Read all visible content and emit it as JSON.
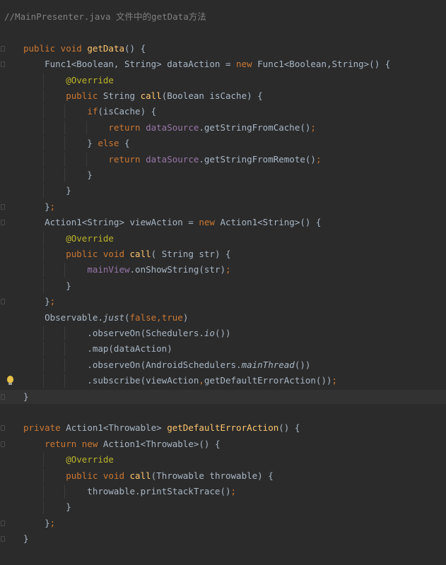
{
  "editor": {
    "current_line_index": 24,
    "lines": [
      {
        "fold": false,
        "bulb": false,
        "tokens": [
          {
            "t": "//MainPresenter.java 文件中的getData方法",
            "c": "comment"
          }
        ]
      },
      {
        "fold": false,
        "bulb": false,
        "tokens": []
      },
      {
        "fold": true,
        "bulb": false,
        "tokens": [
          {
            "t": "public void ",
            "c": "kw"
          },
          {
            "t": "getData",
            "c": "fn"
          },
          {
            "t": "() {",
            "c": "pl"
          }
        ]
      },
      {
        "fold": true,
        "bulb": false,
        "tokens": [
          {
            "t": "    Func1<Boolean, String> dataAction = ",
            "c": "pl"
          },
          {
            "t": "new ",
            "c": "kw"
          },
          {
            "t": "Func1<Boolean,String>() {",
            "c": "pl"
          }
        ]
      },
      {
        "fold": false,
        "bulb": false,
        "tokens": [
          {
            "t": "        ",
            "c": "pl"
          },
          {
            "t": "@Override",
            "c": "ann"
          }
        ]
      },
      {
        "fold": false,
        "bulb": false,
        "tokens": [
          {
            "t": "        ",
            "c": "pl"
          },
          {
            "t": "public ",
            "c": "kw"
          },
          {
            "t": "String ",
            "c": "pl"
          },
          {
            "t": "call",
            "c": "fn"
          },
          {
            "t": "(Boolean isCache) {",
            "c": "pl"
          }
        ]
      },
      {
        "fold": false,
        "bulb": false,
        "tokens": [
          {
            "t": "            ",
            "c": "pl"
          },
          {
            "t": "if",
            "c": "kw"
          },
          {
            "t": "(isCache) {",
            "c": "pl"
          }
        ]
      },
      {
        "fold": false,
        "bulb": false,
        "tokens": [
          {
            "t": "                ",
            "c": "pl"
          },
          {
            "t": "return ",
            "c": "kw"
          },
          {
            "t": "dataSource",
            "c": "fld"
          },
          {
            "t": ".getStringFromCache()",
            "c": "pl"
          },
          {
            "t": ";",
            "c": "kw"
          }
        ]
      },
      {
        "fold": false,
        "bulb": false,
        "tokens": [
          {
            "t": "            } ",
            "c": "pl"
          },
          {
            "t": "else ",
            "c": "kw"
          },
          {
            "t": "{",
            "c": "pl"
          }
        ]
      },
      {
        "fold": false,
        "bulb": false,
        "tokens": [
          {
            "t": "                ",
            "c": "pl"
          },
          {
            "t": "return ",
            "c": "kw"
          },
          {
            "t": "dataSource",
            "c": "fld"
          },
          {
            "t": ".getStringFromRemote()",
            "c": "pl"
          },
          {
            "t": ";",
            "c": "kw"
          }
        ]
      },
      {
        "fold": false,
        "bulb": false,
        "tokens": [
          {
            "t": "            }",
            "c": "pl"
          }
        ]
      },
      {
        "fold": false,
        "bulb": false,
        "tokens": [
          {
            "t": "        }",
            "c": "pl"
          }
        ]
      },
      {
        "fold": true,
        "bulb": false,
        "tokens": [
          {
            "t": "    }",
            "c": "pl"
          },
          {
            "t": ";",
            "c": "kw"
          }
        ]
      },
      {
        "fold": true,
        "bulb": false,
        "tokens": [
          {
            "t": "    Action1<String> viewAction = ",
            "c": "pl"
          },
          {
            "t": "new ",
            "c": "kw"
          },
          {
            "t": "Action1<String>() {",
            "c": "pl"
          }
        ]
      },
      {
        "fold": false,
        "bulb": false,
        "tokens": [
          {
            "t": "        ",
            "c": "pl"
          },
          {
            "t": "@Override",
            "c": "ann"
          }
        ]
      },
      {
        "fold": false,
        "bulb": false,
        "tokens": [
          {
            "t": "        ",
            "c": "pl"
          },
          {
            "t": "public void ",
            "c": "kw"
          },
          {
            "t": "call",
            "c": "fn"
          },
          {
            "t": "( String str) {",
            "c": "pl"
          }
        ]
      },
      {
        "fold": false,
        "bulb": false,
        "tokens": [
          {
            "t": "            ",
            "c": "pl"
          },
          {
            "t": "mainView",
            "c": "fld"
          },
          {
            "t": ".onShowString(str)",
            "c": "pl"
          },
          {
            "t": ";",
            "c": "kw"
          }
        ]
      },
      {
        "fold": false,
        "bulb": false,
        "tokens": [
          {
            "t": "        }",
            "c": "pl"
          }
        ]
      },
      {
        "fold": true,
        "bulb": false,
        "tokens": [
          {
            "t": "    }",
            "c": "pl"
          },
          {
            "t": ";",
            "c": "kw"
          }
        ]
      },
      {
        "fold": false,
        "bulb": false,
        "tokens": [
          {
            "t": "    Observable.",
            "c": "pl"
          },
          {
            "t": "just",
            "c": "it"
          },
          {
            "t": "(",
            "c": "pl"
          },
          {
            "t": "false",
            "c": "kw"
          },
          {
            "t": ",",
            "c": "kw"
          },
          {
            "t": "true",
            "c": "kw"
          },
          {
            "t": ")",
            "c": "pl"
          }
        ]
      },
      {
        "fold": false,
        "bulb": false,
        "tokens": [
          {
            "t": "            .observeOn(Schedulers.",
            "c": "pl"
          },
          {
            "t": "io",
            "c": "it"
          },
          {
            "t": "())",
            "c": "pl"
          }
        ]
      },
      {
        "fold": false,
        "bulb": false,
        "tokens": [
          {
            "t": "            .map(dataAction)",
            "c": "pl"
          }
        ]
      },
      {
        "fold": false,
        "bulb": false,
        "tokens": [
          {
            "t": "            .observeOn(AndroidSchedulers.",
            "c": "pl"
          },
          {
            "t": "mainThread",
            "c": "it"
          },
          {
            "t": "())",
            "c": "pl"
          }
        ]
      },
      {
        "fold": false,
        "bulb": true,
        "tokens": [
          {
            "t": "            .subscribe(viewAction",
            "c": "pl"
          },
          {
            "t": ",",
            "c": "kw"
          },
          {
            "t": "getDefaultErrorAction())",
            "c": "pl"
          },
          {
            "t": ";",
            "c": "kw"
          }
        ]
      },
      {
        "fold": true,
        "bulb": false,
        "tokens": [
          {
            "t": "}",
            "c": "pl"
          }
        ]
      },
      {
        "fold": false,
        "bulb": false,
        "tokens": []
      },
      {
        "fold": true,
        "bulb": false,
        "tokens": [
          {
            "t": "private ",
            "c": "kw"
          },
          {
            "t": "Action1<Throwable> ",
            "c": "pl"
          },
          {
            "t": "getDefaultErrorAction",
            "c": "fn"
          },
          {
            "t": "() {",
            "c": "pl"
          }
        ]
      },
      {
        "fold": true,
        "bulb": false,
        "tokens": [
          {
            "t": "    ",
            "c": "pl"
          },
          {
            "t": "return new ",
            "c": "kw"
          },
          {
            "t": "Action1<Throwable>() {",
            "c": "pl"
          }
        ]
      },
      {
        "fold": false,
        "bulb": false,
        "tokens": [
          {
            "t": "        ",
            "c": "pl"
          },
          {
            "t": "@Override",
            "c": "ann"
          }
        ]
      },
      {
        "fold": false,
        "bulb": false,
        "tokens": [
          {
            "t": "        ",
            "c": "pl"
          },
          {
            "t": "public void ",
            "c": "kw"
          },
          {
            "t": "call",
            "c": "fn"
          },
          {
            "t": "(Throwable throwable) {",
            "c": "pl"
          }
        ]
      },
      {
        "fold": false,
        "bulb": false,
        "tokens": [
          {
            "t": "            throwable.printStackTrace()",
            "c": "pl"
          },
          {
            "t": ";",
            "c": "kw"
          }
        ]
      },
      {
        "fold": false,
        "bulb": false,
        "tokens": [
          {
            "t": "        }",
            "c": "pl"
          }
        ]
      },
      {
        "fold": true,
        "bulb": false,
        "tokens": [
          {
            "t": "    }",
            "c": "pl"
          },
          {
            "t": ";",
            "c": "kw"
          }
        ]
      },
      {
        "fold": true,
        "bulb": false,
        "tokens": [
          {
            "t": "}",
            "c": "pl"
          }
        ]
      }
    ]
  }
}
